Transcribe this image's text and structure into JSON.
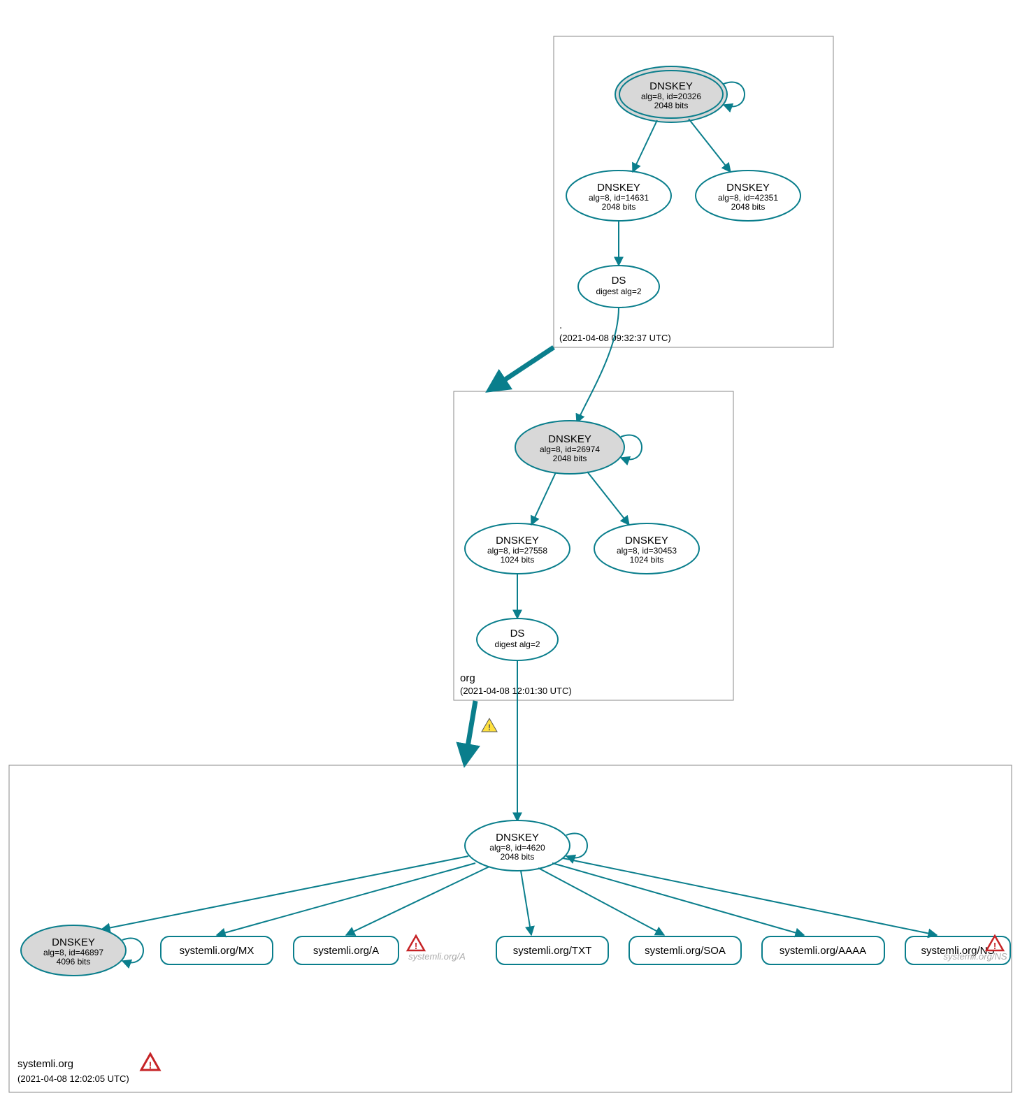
{
  "zones": {
    "root": {
      "name": ".",
      "timestamp": "(2021-04-08 09:32:37 UTC)"
    },
    "org": {
      "name": "org",
      "timestamp": "(2021-04-08 12:01:30 UTC)"
    },
    "systemli": {
      "name": "systemli.org",
      "timestamp": "(2021-04-08 12:02:05 UTC)"
    }
  },
  "nodes": {
    "root_ksk": {
      "title": "DNSKEY",
      "sub1": "alg=8, id=20326",
      "sub2": "2048 bits"
    },
    "root_zsk1": {
      "title": "DNSKEY",
      "sub1": "alg=8, id=14631",
      "sub2": "2048 bits"
    },
    "root_zsk2": {
      "title": "DNSKEY",
      "sub1": "alg=8, id=42351",
      "sub2": "2048 bits"
    },
    "root_ds": {
      "title": "DS",
      "sub1": "digest alg=2"
    },
    "org_ksk": {
      "title": "DNSKEY",
      "sub1": "alg=8, id=26974",
      "sub2": "2048 bits"
    },
    "org_zsk1": {
      "title": "DNSKEY",
      "sub1": "alg=8, id=27558",
      "sub2": "1024 bits"
    },
    "org_zsk2": {
      "title": "DNSKEY",
      "sub1": "alg=8, id=30453",
      "sub2": "1024 bits"
    },
    "org_ds": {
      "title": "DS",
      "sub1": "digest alg=2"
    },
    "sys_ksk": {
      "title": "DNSKEY",
      "sub1": "alg=8, id=4620",
      "sub2": "2048 bits"
    },
    "sys_zsk": {
      "title": "DNSKEY",
      "sub1": "alg=8, id=46897",
      "sub2": "4096 bits"
    }
  },
  "rrsets": {
    "mx": "systemli.org/MX",
    "a": "systemli.org/A",
    "a_warn": "systemli.org/A",
    "txt": "systemli.org/TXT",
    "soa": "systemli.org/SOA",
    "aaaa": "systemli.org/AAAA",
    "ns": "systemli.org/NS",
    "ns_warn": "systemli.org/NS"
  },
  "colors": {
    "stroke": "#0a7e8c",
    "fill_grey": "#d8d8d8",
    "warn_red": "#c62326",
    "warn_yellow": "#ffe13e",
    "warn_grey": "#aaaaaa"
  }
}
